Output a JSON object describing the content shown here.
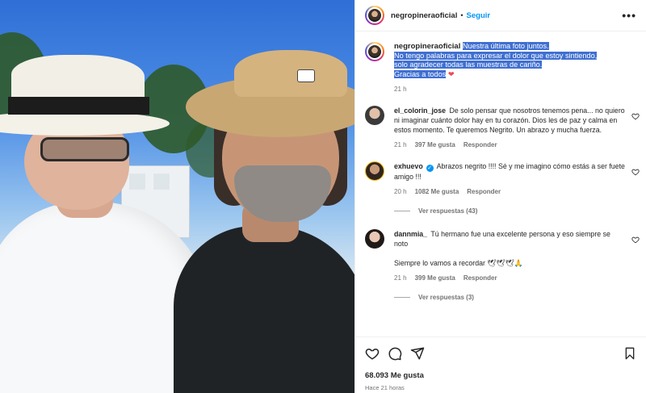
{
  "post": {
    "username": "negropineraoficial",
    "follow_label": "Seguir",
    "separator": "•",
    "more_label": "•••",
    "caption": {
      "username": "negropineraoficial",
      "lines": [
        "Nuestra última foto juntos.",
        "No tengo palabras para expresar el dolor que estoy sintiendo,",
        "solo agradecer todas las muestras de cariño.",
        "Gracias a todos"
      ],
      "emoji": "❤",
      "time": "21 h"
    },
    "comments": [
      {
        "username": "el_colorin_jose",
        "text": "De solo pensar que nosotros tenemos pena... no quiero ni imaginar cuánto dolor hay en tu corazón. Dios les de paz y calma en estos momento. Te queremos Negrito. Un abrazo y mucha fuerza.",
        "time": "21 h",
        "likes": "397 Me gusta",
        "reply": "Responder"
      },
      {
        "username": "exhuevo",
        "verified": true,
        "text": "Abrazos negrito !!!! Sé y me imagino cómo estás a ser fuete amigo !!!",
        "time": "20 h",
        "likes": "1082 Me gusta",
        "reply": "Responder",
        "view_replies": "Ver respuestas (43)"
      },
      {
        "username": "dannmia_",
        "text": "Tú hermano fue una excelente persona y eso siempre se noto",
        "text2": "Siempre lo vamos a recordar 🕊🕊🕊🙏",
        "time": "21 h",
        "likes": "399 Me gusta",
        "reply": "Responder",
        "view_replies": "Ver respuestas (3)"
      }
    ],
    "likes_total": "68.093 Me gusta",
    "posted_ago": "Hace 21 horas"
  },
  "colors": {
    "accent": "#0095f6",
    "highlight": "#3f6fd1",
    "heart": "#ed4956",
    "muted": "#737373"
  },
  "icons": [
    "heart-icon",
    "comment-icon",
    "share-icon",
    "bookmark-icon",
    "more-options-icon",
    "verified-badge-icon"
  ]
}
